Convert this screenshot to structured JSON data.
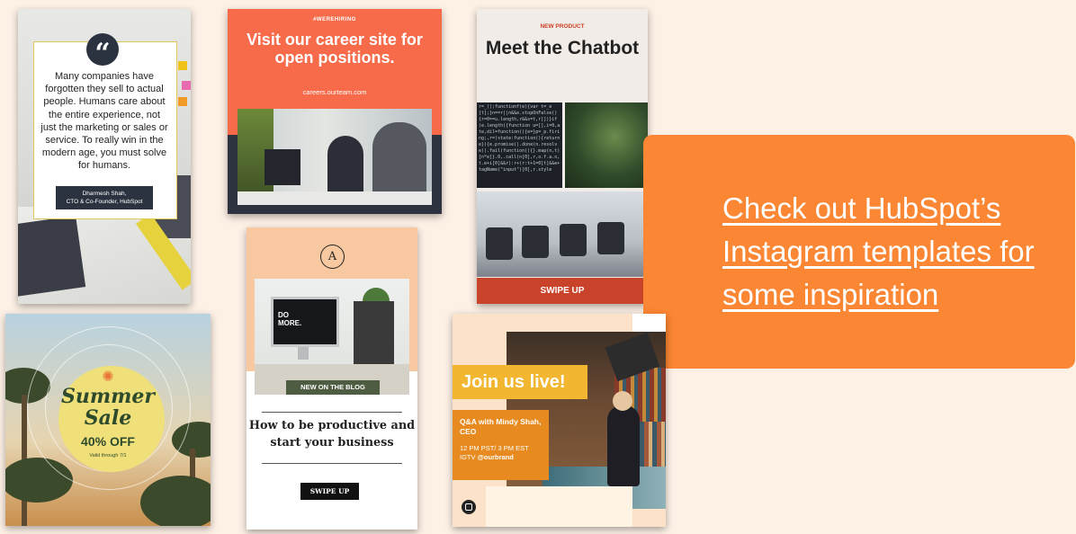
{
  "quote_card": {
    "icon": "quote-icon",
    "quote": "Many companies have forgotten they sell to actual people. Humans care about the entire experience, not just the marketing or sales or service. To really win in the modern age, you must solve for humans.",
    "author_name": "Dharmesh Shah,",
    "author_title": "CTO & Co-Founder, HubSpot"
  },
  "hiring_card": {
    "tag": "#WEREHIRING",
    "title": "Visit our career site for open positions.",
    "url": "careers.ourteam.com"
  },
  "chatbot_card": {
    "tag": "NEW PRODUCT",
    "title": "Meet the Chatbot",
    "cta": "SWIPE UP"
  },
  "cta_panel": {
    "text": "Check out HubSpot’s Instagram templates for some inspiration",
    "color": "#fb8633"
  },
  "summer_card": {
    "icon": "sun-icon",
    "title_line1": "Summer",
    "title_line2": "Sale",
    "discount": "40% OFF",
    "validity": "Valid through 7/1"
  },
  "blog_card": {
    "icon": "monogram-a-icon",
    "monogram": "A",
    "screen_text_line1": "DO",
    "screen_text_line2": "MORE.",
    "label": "NEW ON THE BLOG",
    "title": "How to be productive and start your business",
    "cta": "SWIPE UP"
  },
  "live_card": {
    "title": "Join us live!",
    "host": "Q&A with Mindy Shah, CEO",
    "time": "12 PM PST/ 3 PM EST",
    "channel_prefix": "IGTV ",
    "channel_handle": "@ourbrand",
    "logo_icon": "brand-logo-icon"
  }
}
